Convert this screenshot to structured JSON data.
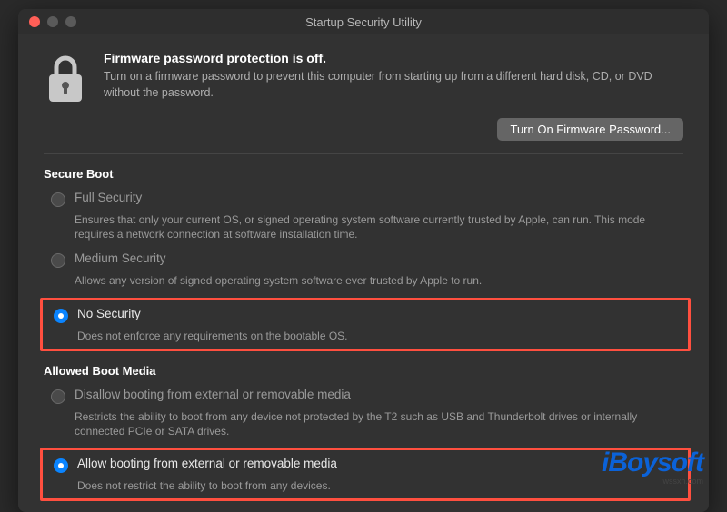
{
  "window": {
    "title": "Startup Security Utility"
  },
  "firmware": {
    "heading": "Firmware password protection is off.",
    "desc": "Turn on a firmware password to prevent this computer from starting up from a different hard disk, CD, or DVD without the password.",
    "button": "Turn On Firmware Password..."
  },
  "secure_boot": {
    "title": "Secure Boot",
    "options": [
      {
        "label": "Full Security",
        "desc": "Ensures that only your current OS, or signed operating system software currently trusted by Apple, can run. This mode requires a network connection at software installation time."
      },
      {
        "label": "Medium Security",
        "desc": "Allows any version of signed operating system software ever trusted by Apple to run."
      },
      {
        "label": "No Security",
        "desc": "Does not enforce any requirements on the bootable OS."
      }
    ]
  },
  "boot_media": {
    "title": "Allowed Boot Media",
    "options": [
      {
        "label": "Disallow booting from external or removable media",
        "desc": "Restricts the ability to boot from any device not protected by the T2 such as USB and Thunderbolt drives or internally connected PCIe or SATA drives."
      },
      {
        "label": "Allow booting from external or removable media",
        "desc": "Does not restrict the ability to boot from any devices."
      }
    ]
  },
  "watermark": {
    "brand": "iBoysoft",
    "sub": "wssxh.com"
  }
}
